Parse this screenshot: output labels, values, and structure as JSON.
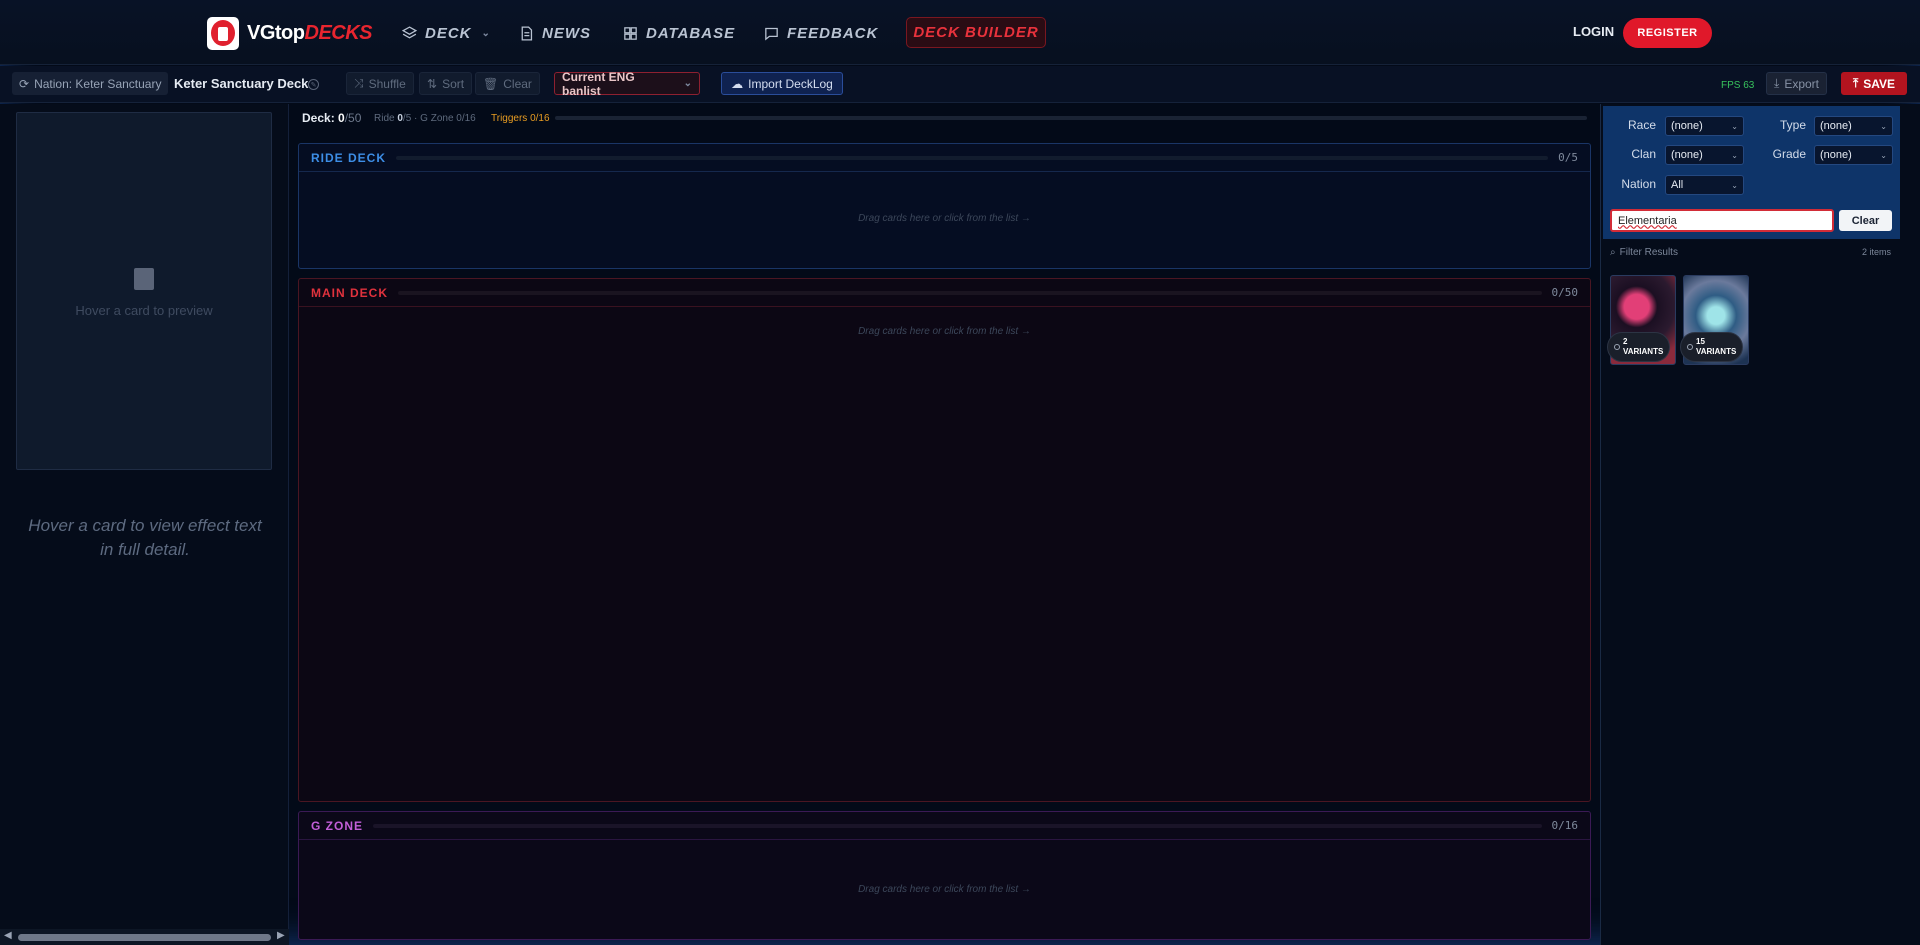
{
  "nav": {
    "logo_white": "VGtop",
    "logo_red": "DECKS",
    "items": [
      {
        "label": "DECK",
        "icon": "layers-icon"
      },
      {
        "label": "NEWS",
        "icon": "document-icon"
      },
      {
        "label": "DATABASE",
        "icon": "grid-icon"
      },
      {
        "label": "FEEDBACK",
        "icon": "chat-icon"
      }
    ],
    "deck_builder": "DECK BUILDER",
    "login": "LOGIN",
    "register": "REGISTER"
  },
  "toolbar": {
    "nation": "Nation: Keter Sanctuary",
    "deck_name": "Keter Sanctuary Deck",
    "shuffle": "Shuffle",
    "sort": "Sort",
    "clear": "Clear",
    "banlist": "Current ENG banlist",
    "import": "Import DeckLog",
    "fps_label": "FPS",
    "fps_value": "63",
    "export": "Export",
    "save": "SAVE"
  },
  "preview": {
    "hint": "Hover a card to preview",
    "effect_hint": "Hover a card to view effect text in full detail."
  },
  "deck_summary": {
    "deck_label": "Deck:",
    "deck_count": "0",
    "deck_max": "/50",
    "ride_label": "Ride",
    "ride_count": "0",
    "ride_max": "/5",
    "gzone_text": "· G Zone 0/16",
    "triggers": "Triggers 0/16"
  },
  "zones": {
    "ride": {
      "title": "RIDE DECK",
      "count": "0/5",
      "hint": "Drag cards here or click from the list →"
    },
    "main": {
      "title": "MAIN DECK",
      "count": "0/50",
      "hint": "Drag cards here or click from the list →"
    },
    "gzone": {
      "title": "G ZONE",
      "count": "0/16",
      "hint": "Drag cards here or click from the list →"
    }
  },
  "filters": {
    "race": {
      "label": "Race",
      "value": "(none)"
    },
    "type": {
      "label": "Type",
      "value": "(none)"
    },
    "clan": {
      "label": "Clan",
      "value": "(none)"
    },
    "grade": {
      "label": "Grade",
      "value": "(none)"
    },
    "nation": {
      "label": "Nation",
      "value": "All"
    },
    "search_value": "Elementaria",
    "clear": "Clear",
    "filter_results": "Filter Results",
    "item_count": "2 items"
  },
  "results": [
    {
      "variants_count": "2",
      "variants_label": "VARIANTS"
    },
    {
      "variants_count": "15",
      "variants_label": "VARIANTS"
    }
  ],
  "colors": {
    "brand_red": "#e0182a",
    "ride_blue": "#3d8ee6",
    "main_red": "#e0323d",
    "gzone_purple": "#c25ed8",
    "trigger_orange": "#e89c22"
  }
}
